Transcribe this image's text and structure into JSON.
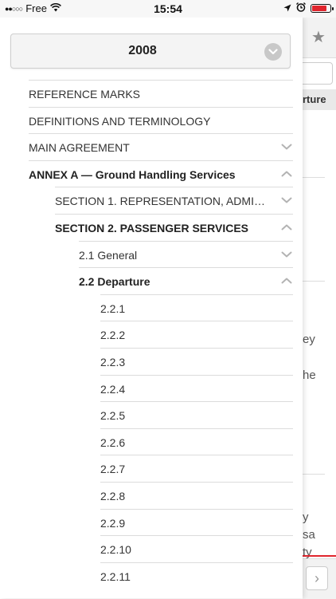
{
  "status_bar": {
    "signal_dots": "●●○○○",
    "carrier": "Free",
    "time": "15:54"
  },
  "background": {
    "tab_fragment": "rture",
    "text_fragments": [
      "ey",
      "he",
      "y",
      "sa",
      "ty"
    ]
  },
  "drawer": {
    "year": "2008",
    "toc": [
      {
        "label": "REFERENCE MARKS",
        "level": 0,
        "bold": false,
        "icon": ""
      },
      {
        "label": "DEFINITIONS AND TERMINOLOGY",
        "level": 0,
        "bold": false,
        "icon": ""
      },
      {
        "label": "MAIN AGREEMENT",
        "level": 0,
        "bold": false,
        "icon": "chevron-down-icon"
      },
      {
        "label": "ANNEX A — Ground Handling Services",
        "level": 0,
        "bold": true,
        "icon": "chevron-up-icon"
      },
      {
        "label": "SECTION 1. REPRESENTATION, ADMINISTR…",
        "level": 1,
        "bold": false,
        "icon": "chevron-down-icon"
      },
      {
        "label": "SECTION 2. PASSENGER SERVICES",
        "level": 1,
        "bold": true,
        "icon": "chevron-up-icon"
      },
      {
        "label": "2.1 General",
        "level": 2,
        "bold": false,
        "icon": "chevron-down-icon"
      },
      {
        "label": "2.2 Departure",
        "level": 2,
        "bold": true,
        "icon": "chevron-up-icon"
      },
      {
        "label": "2.2.1",
        "level": 3,
        "bold": false,
        "icon": ""
      },
      {
        "label": "2.2.2",
        "level": 3,
        "bold": false,
        "icon": ""
      },
      {
        "label": "2.2.3",
        "level": 3,
        "bold": false,
        "icon": ""
      },
      {
        "label": "2.2.4",
        "level": 3,
        "bold": false,
        "icon": ""
      },
      {
        "label": "2.2.5",
        "level": 3,
        "bold": false,
        "icon": ""
      },
      {
        "label": "2.2.6",
        "level": 3,
        "bold": false,
        "icon": ""
      },
      {
        "label": "2.2.7",
        "level": 3,
        "bold": false,
        "icon": ""
      },
      {
        "label": "2.2.8",
        "level": 3,
        "bold": false,
        "icon": ""
      },
      {
        "label": "2.2.9",
        "level": 3,
        "bold": false,
        "icon": ""
      },
      {
        "label": "2.2.10",
        "level": 3,
        "bold": false,
        "icon": ""
      },
      {
        "label": "2.2.11",
        "level": 3,
        "bold": false,
        "icon": ""
      }
    ]
  }
}
